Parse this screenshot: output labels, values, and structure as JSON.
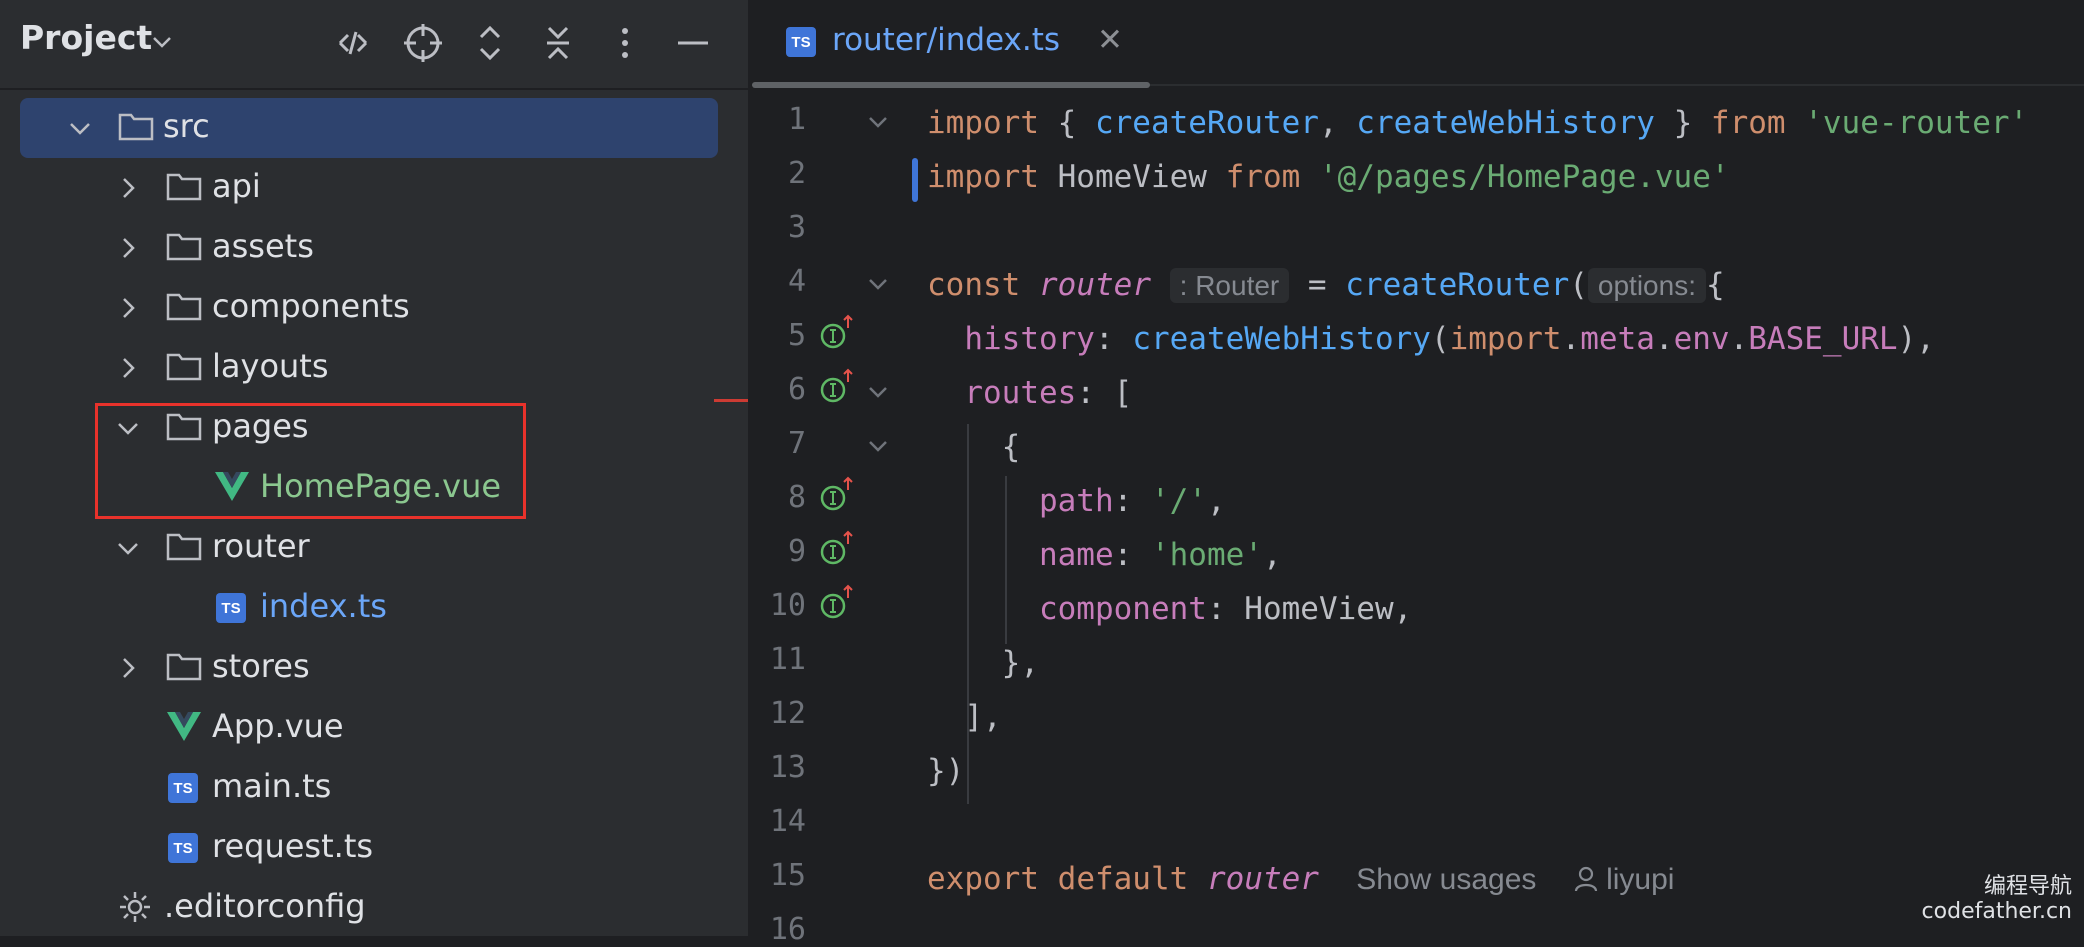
{
  "project": {
    "title": "Project",
    "toolbar_icons": [
      "diff-icon",
      "locate-icon",
      "expand-all-icon",
      "collapse-all-icon",
      "more-icon",
      "minimize-icon"
    ],
    "tree": [
      {
        "label": "src",
        "type": "folder",
        "expanded": true,
        "selected": true
      },
      {
        "label": "api",
        "type": "folder",
        "expanded": false
      },
      {
        "label": "assets",
        "type": "folder",
        "expanded": false
      },
      {
        "label": "components",
        "type": "folder",
        "expanded": false
      },
      {
        "label": "layouts",
        "type": "folder",
        "expanded": false
      },
      {
        "label": "pages",
        "type": "folder",
        "expanded": true
      },
      {
        "label": "HomePage.vue",
        "type": "vue"
      },
      {
        "label": "router",
        "type": "folder",
        "expanded": true
      },
      {
        "label": "index.ts",
        "type": "ts"
      },
      {
        "label": "stores",
        "type": "folder",
        "expanded": false
      },
      {
        "label": "App.vue",
        "type": "vue"
      },
      {
        "label": "main.ts",
        "type": "ts"
      },
      {
        "label": "request.ts",
        "type": "ts"
      },
      {
        "label": ".editorconfig",
        "type": "config"
      }
    ]
  },
  "editor": {
    "tab": {
      "label": "router/index.ts",
      "badge": "TS"
    },
    "line_numbers": [
      "1",
      "2",
      "3",
      "4",
      "5",
      "6",
      "7",
      "8",
      "9",
      "10",
      "11",
      "12",
      "13",
      "14",
      "15",
      "16"
    ],
    "code": {
      "l1": {
        "k1": "import",
        "p1": " { ",
        "f1": "createRouter",
        "p2": ", ",
        "f2": "createWebHistory",
        "p3": " } ",
        "k2": "from",
        "p4": " ",
        "s1": "'vue-router'"
      },
      "l2": {
        "k1": "import",
        "p1": " HomeView ",
        "k2": "from",
        "p2": " ",
        "s1": "'@/pages/HomePage.vue'"
      },
      "l4": {
        "k1": "const",
        "p1": " ",
        "v1": "router",
        "hint1": ": Router",
        "p2": " = ",
        "f1": "createRouter",
        "p3": "(",
        "hint2": "options:",
        "p4": "{"
      },
      "l5": {
        "p0": "  ",
        "pr1": "history",
        "p1": ": ",
        "f1": "createWebHistory",
        "p2": "(",
        "k1": "import",
        "p3": ".",
        "pr2": "meta",
        "p4": ".",
        "pr3": "env",
        "p5": ".",
        "pr4": "BASE_URL",
        "p6": "),"
      },
      "l6": {
        "p0": "  ",
        "pr1": "routes",
        "p1": ": ["
      },
      "l7": {
        "p0": "    {"
      },
      "l8": {
        "p0": "      ",
        "pr1": "path",
        "p1": ": ",
        "s1": "'/'",
        "p2": ","
      },
      "l9": {
        "p0": "      ",
        "pr1": "name",
        "p1": ": ",
        "s1": "'home'",
        "p2": ","
      },
      "l10": {
        "p0": "      ",
        "pr1": "component",
        "p1": ": HomeView,"
      },
      "l11": {
        "p0": "    },"
      },
      "l12": {
        "p0": "  ],"
      },
      "l13": {
        "p0": "})"
      },
      "l15": {
        "k1": "export",
        "p1": " ",
        "k2": "default",
        "p2": " ",
        "v1": "router",
        "u1": "Show usages",
        "u2": "liyupi"
      }
    }
  },
  "watermark": {
    "line1": "编程导航",
    "line2": "codefather.cn"
  },
  "colors": {
    "accent_blue": "#6ba6f8",
    "selection": "#2e436e",
    "highlight_border": "#e8322b",
    "vue_green": "#41b883"
  }
}
